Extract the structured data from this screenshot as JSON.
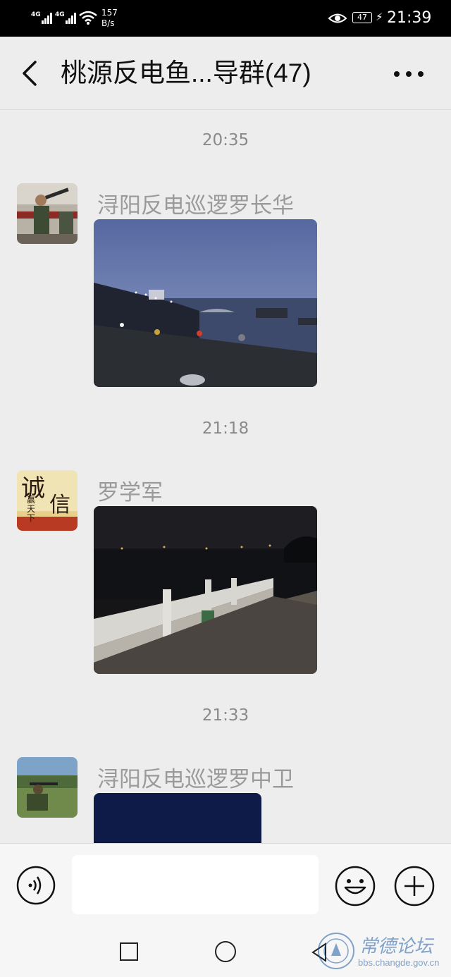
{
  "status_bar": {
    "net1": "4G",
    "net2": "4G",
    "speed_value": "157",
    "speed_unit": "B/s",
    "battery": "47",
    "time": "21:39"
  },
  "nav": {
    "title": "桃源反电鱼...导群(47)",
    "back_icon": "chevron-left-icon",
    "more_icon": "more-dots-icon"
  },
  "messages": [
    {
      "time": "20:35",
      "sender": "浔阳反电巡逻罗长华",
      "content": "river-at-dusk-photo"
    },
    {
      "time": "21:18",
      "sender": "罗学军",
      "avatar_text_1": "诚",
      "avatar_text_2": "信",
      "avatar_text_3": "赢天下",
      "content": "riverside-railing-night-photo"
    },
    {
      "time": "21:33",
      "sender": "浔阳反电巡逻罗中卫",
      "content": "dark-night-photo"
    }
  ],
  "input_bar": {
    "placeholder": "",
    "voice_icon": "voice-icon",
    "emoji_icon": "emoji-icon",
    "plus_icon": "plus-icon"
  },
  "watermark": {
    "title": "常德论坛",
    "url": "bbs.changde.gov.cn"
  },
  "colors": {
    "background": "#ededed",
    "status_bar": "#000000",
    "timestamp": "#8a8a8a",
    "sender_name": "#9a9a9a",
    "watermark": "#1f5fa8"
  }
}
